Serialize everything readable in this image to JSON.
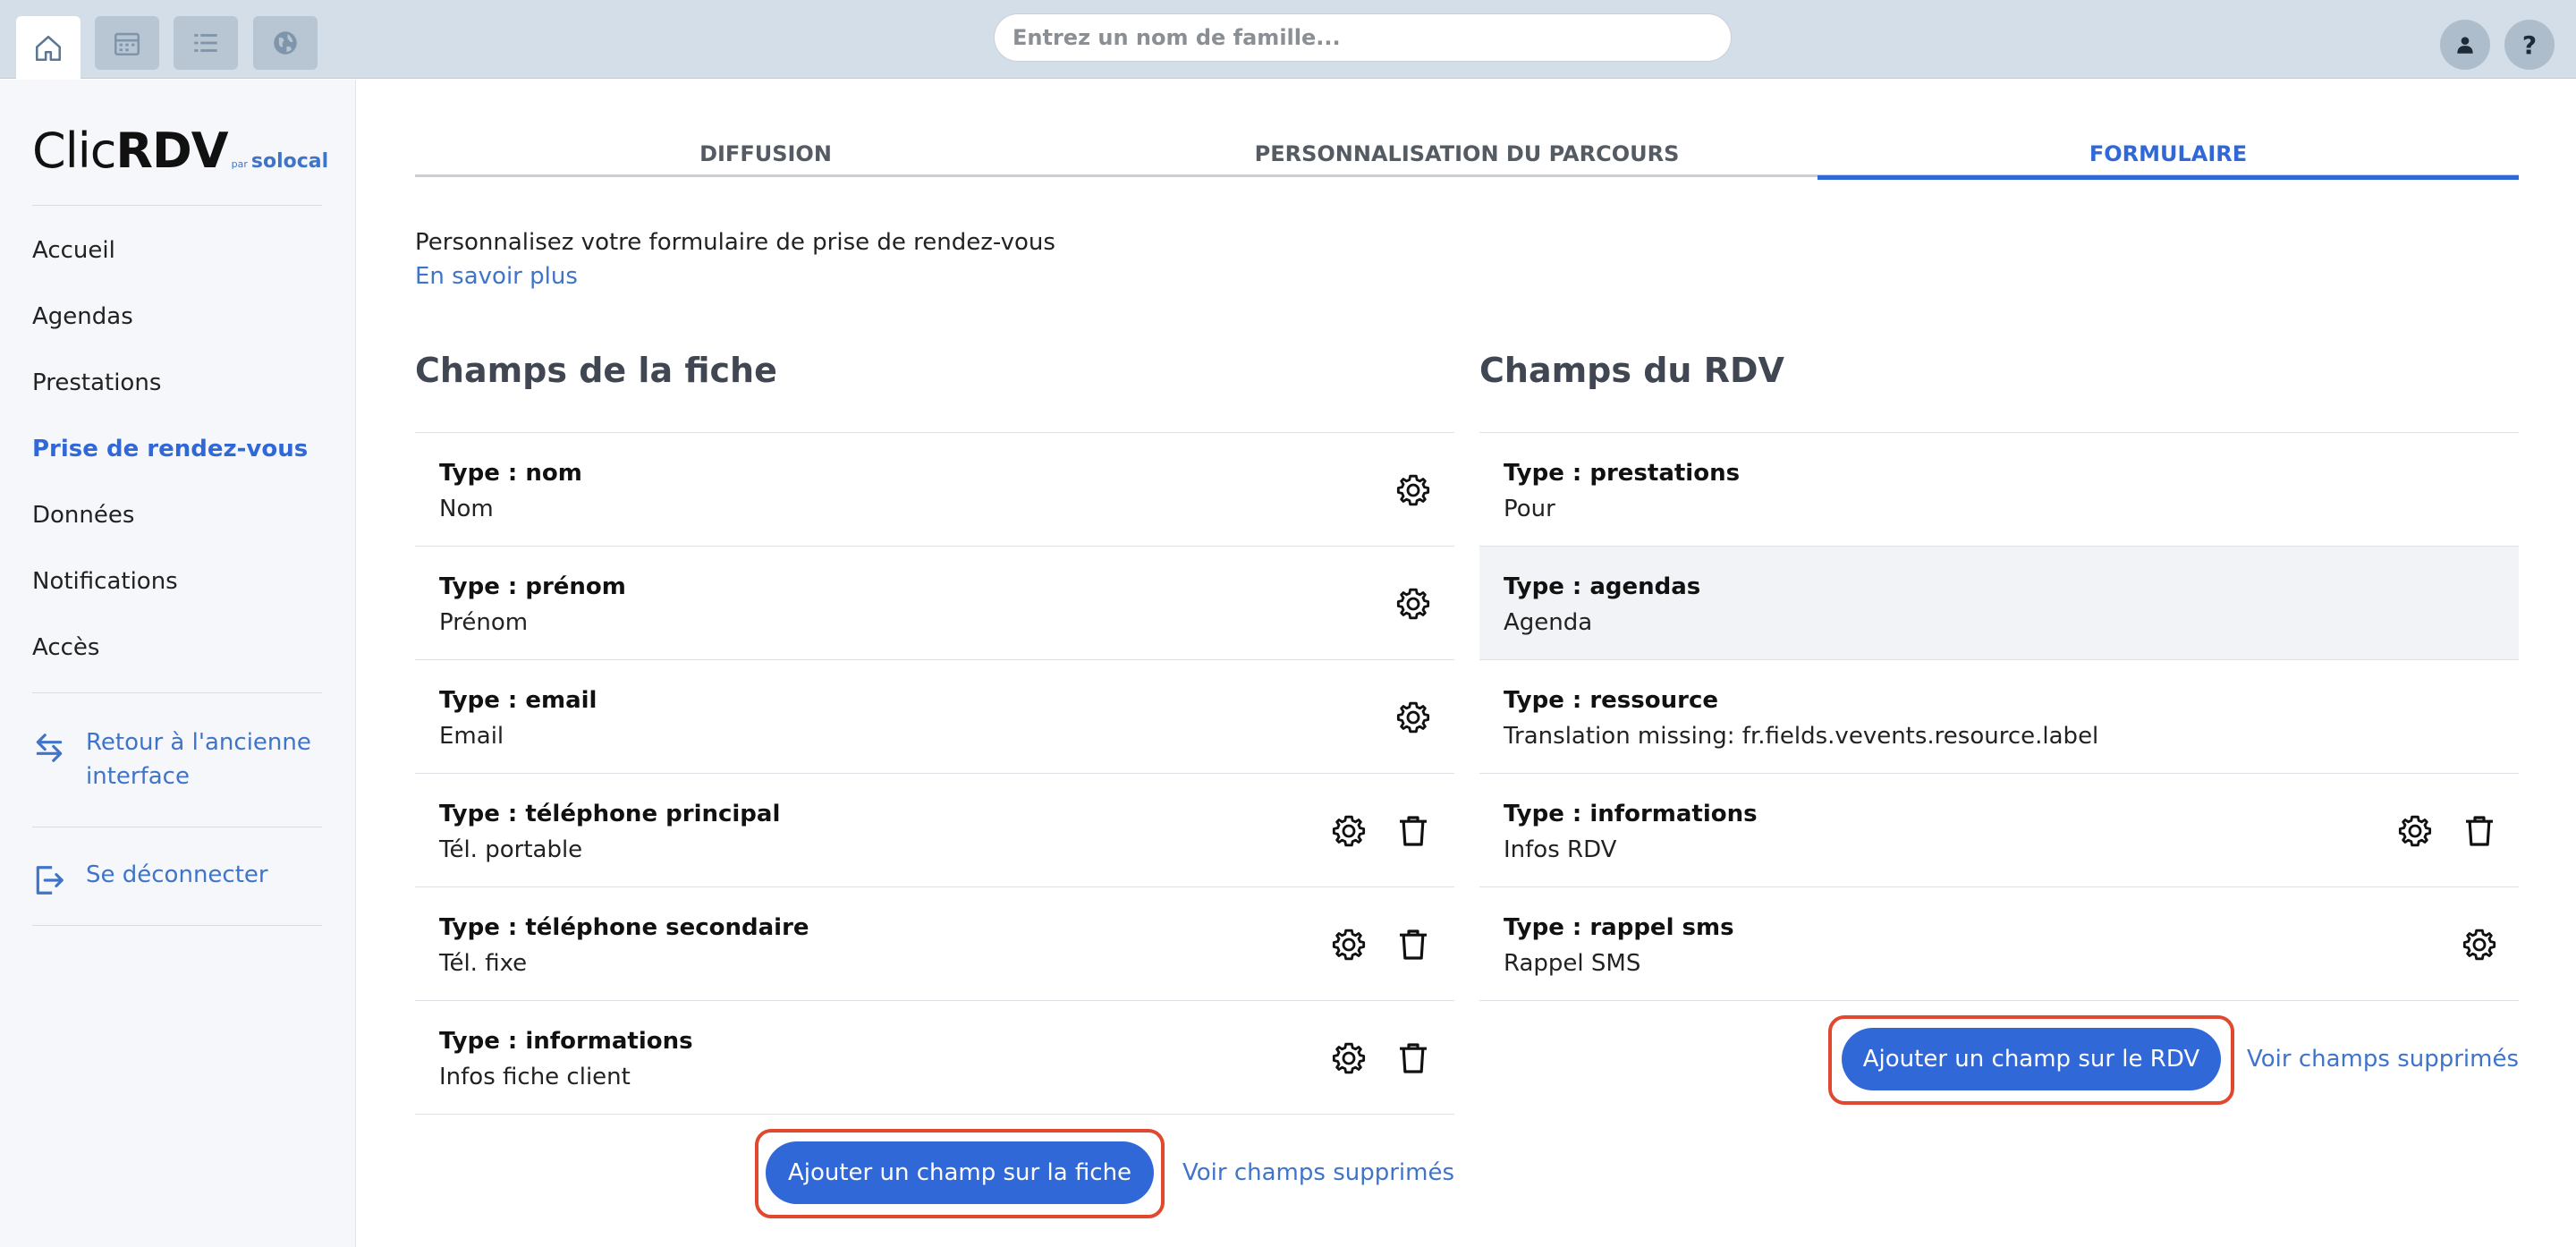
{
  "topbar": {
    "icons": [
      "home-icon",
      "calendar-icon",
      "list-icon",
      "globe-icon"
    ],
    "search_placeholder": "Entrez un nom de famille...",
    "help_label": "?"
  },
  "sidebar": {
    "logo": {
      "clic": "Clic",
      "rdv": "RDV",
      "par": "par",
      "brand": "solocal"
    },
    "items": [
      {
        "label": "Accueil",
        "active": false
      },
      {
        "label": "Agendas",
        "active": false
      },
      {
        "label": "Prestations",
        "active": false
      },
      {
        "label": "Prise de rendez-vous",
        "active": true
      },
      {
        "label": "Données",
        "active": false
      },
      {
        "label": "Notifications",
        "active": false
      },
      {
        "label": "Accès",
        "active": false
      }
    ],
    "back_link": {
      "line1": "Retour à l'ancienne",
      "line2": "interface"
    },
    "logout_link": "Se déconnecter"
  },
  "tabs": [
    {
      "label": "DIFFUSION",
      "active": false
    },
    {
      "label": "PERSONNALISATION DU PARCOURS",
      "active": false
    },
    {
      "label": "FORMULAIRE",
      "active": true
    }
  ],
  "intro": {
    "text": "Personnalisez votre formulaire de prise de rendez-vous",
    "link": "En savoir plus"
  },
  "fiche": {
    "title": "Champs de la fiche",
    "rows": [
      {
        "type": "Type : nom",
        "label": "Nom",
        "deletable": false
      },
      {
        "type": "Type : prénom",
        "label": "Prénom",
        "deletable": false
      },
      {
        "type": "Type : email",
        "label": "Email",
        "deletable": false
      },
      {
        "type": "Type : téléphone principal",
        "label": "Tél. portable",
        "deletable": true
      },
      {
        "type": "Type : téléphone secondaire",
        "label": "Tél. fixe",
        "deletable": true
      },
      {
        "type": "Type : informations",
        "label": "Infos fiche client",
        "deletable": true
      }
    ],
    "add_button": "Ajouter un champ sur la fiche",
    "deleted_link": "Voir champs supprimés"
  },
  "rdv": {
    "title": "Champs du RDV",
    "rows": [
      {
        "type": "Type : prestations",
        "label": "Pour",
        "gear": false,
        "deletable": false
      },
      {
        "type": "Type : agendas",
        "label": "Agenda",
        "gear": false,
        "deletable": false,
        "highlighted": true
      },
      {
        "type": "Type : ressource",
        "label": "Translation missing: fr.fields.vevents.resource.label",
        "gear": false,
        "deletable": false
      },
      {
        "type": "Type : informations",
        "label": "Infos RDV",
        "gear": true,
        "deletable": true
      },
      {
        "type": "Type : rappel sms",
        "label": "Rappel SMS",
        "gear": true,
        "deletable": false
      }
    ],
    "add_button": "Ajouter un champ sur le RDV",
    "deleted_link": "Voir champs supprimés"
  },
  "colors": {
    "accent": "#3168d8",
    "link": "#3f74c9",
    "highlight_outline": "#e0492f",
    "topbar": "#d3dee8",
    "sidebar": "#f5f7fa"
  }
}
